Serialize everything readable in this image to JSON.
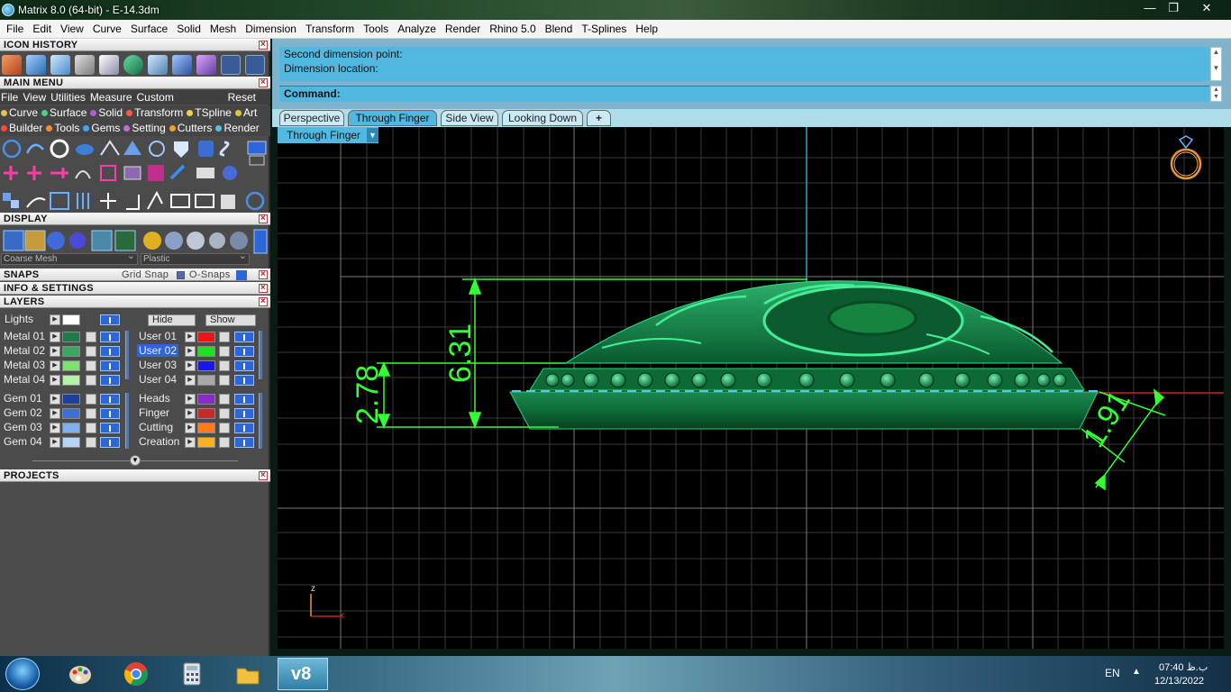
{
  "window": {
    "title": "Matrix 8.0 (64-bit) - E-14.3dm",
    "min": "—",
    "max": "❐",
    "close": "✕"
  },
  "menubar": [
    "File",
    "Edit",
    "View",
    "Curve",
    "Surface",
    "Solid",
    "Mesh",
    "Dimension",
    "Transform",
    "Tools",
    "Analyze",
    "Render",
    "Rhino 5.0",
    "Blend",
    "T-Splines",
    "Help"
  ],
  "left_panel": {
    "icon_history": "ICON HISTORY",
    "main_menu": "MAIN MENU",
    "main_menu_items": [
      "File",
      "View",
      "Utilities",
      "Measure",
      "Custom"
    ],
    "reset": "Reset",
    "categories_row1": [
      {
        "label": "Curve",
        "color": "#e8c44a"
      },
      {
        "label": "Surface",
        "color": "#4fd07f"
      },
      {
        "label": "Solid",
        "color": "#b45cd8"
      },
      {
        "label": "Transform",
        "color": "#ff5a3a"
      },
      {
        "label": "TSpline",
        "color": "#f3d23d"
      },
      {
        "label": "Art",
        "color": "#e6c43a"
      }
    ],
    "categories_row2": [
      {
        "label": "Builder",
        "color": "#ff4a3a"
      },
      {
        "label": "Tools",
        "color": "#ff8a2a"
      },
      {
        "label": "Gems",
        "color": "#3aa8ff"
      },
      {
        "label": "Setting",
        "color": "#c86ad8"
      },
      {
        "label": "Cutters",
        "color": "#f0a030"
      },
      {
        "label": "Render",
        "color": "#58c0e8"
      }
    ],
    "display": "DISPLAY",
    "mesh_select": "Coarse Mesh",
    "material_select": "Plastic",
    "snaps": "SNAPS",
    "grid_snap": "Grid Snap",
    "osnaps": "O-Snaps",
    "info_settings": "INFO & SETTINGS",
    "layers": "LAYERS",
    "lights": "Lights",
    "hide": "Hide",
    "show": "Show",
    "projects": "PROJECTS",
    "layers_left": [
      {
        "name": "Metal 01",
        "color": "#1f7a4a"
      },
      {
        "name": "Metal 02",
        "color": "#3aa860"
      },
      {
        "name": "Metal 03",
        "color": "#7fe070"
      },
      {
        "name": "Metal 04",
        "color": "#b6f0a8"
      },
      {
        "name": "Gem 01",
        "color": "#1c3fa0"
      },
      {
        "name": "Gem 02",
        "color": "#3f6fd0"
      },
      {
        "name": "Gem 03",
        "color": "#7fb0f0"
      },
      {
        "name": "Gem 04",
        "color": "#b6d4f8"
      }
    ],
    "layers_right": [
      {
        "name": "User 01",
        "color": "#e81818"
      },
      {
        "name": "User 02",
        "color": "#22dd22"
      },
      {
        "name": "User 03",
        "color": "#1818e0"
      },
      {
        "name": "User 04",
        "color": "#a8a8a8"
      },
      {
        "name": "Heads",
        "color": "#8a2ac8"
      },
      {
        "name": "Finger",
        "color": "#c82a2a"
      },
      {
        "name": "Cutting",
        "color": "#ff7a1a"
      },
      {
        "name": "Creation",
        "color": "#ffb020"
      }
    ]
  },
  "command": {
    "history_line1": "Second dimension point:",
    "history_line2": "Dimension location:",
    "prompt": "Command:"
  },
  "tabs": [
    "Perspective",
    "Through Finger",
    "Side View",
    "Looking Down"
  ],
  "add_tab": "+",
  "viewport": {
    "label": "Through Finger",
    "dim1": "6.31",
    "dim2": "2.78",
    "dim3": "1.91",
    "axis_z": "z",
    "axis_x": "x"
  },
  "taskbar": {
    "app_label": "v8",
    "language": "EN",
    "time": "07:40 ب.ظ",
    "date": "12/13/2022"
  }
}
